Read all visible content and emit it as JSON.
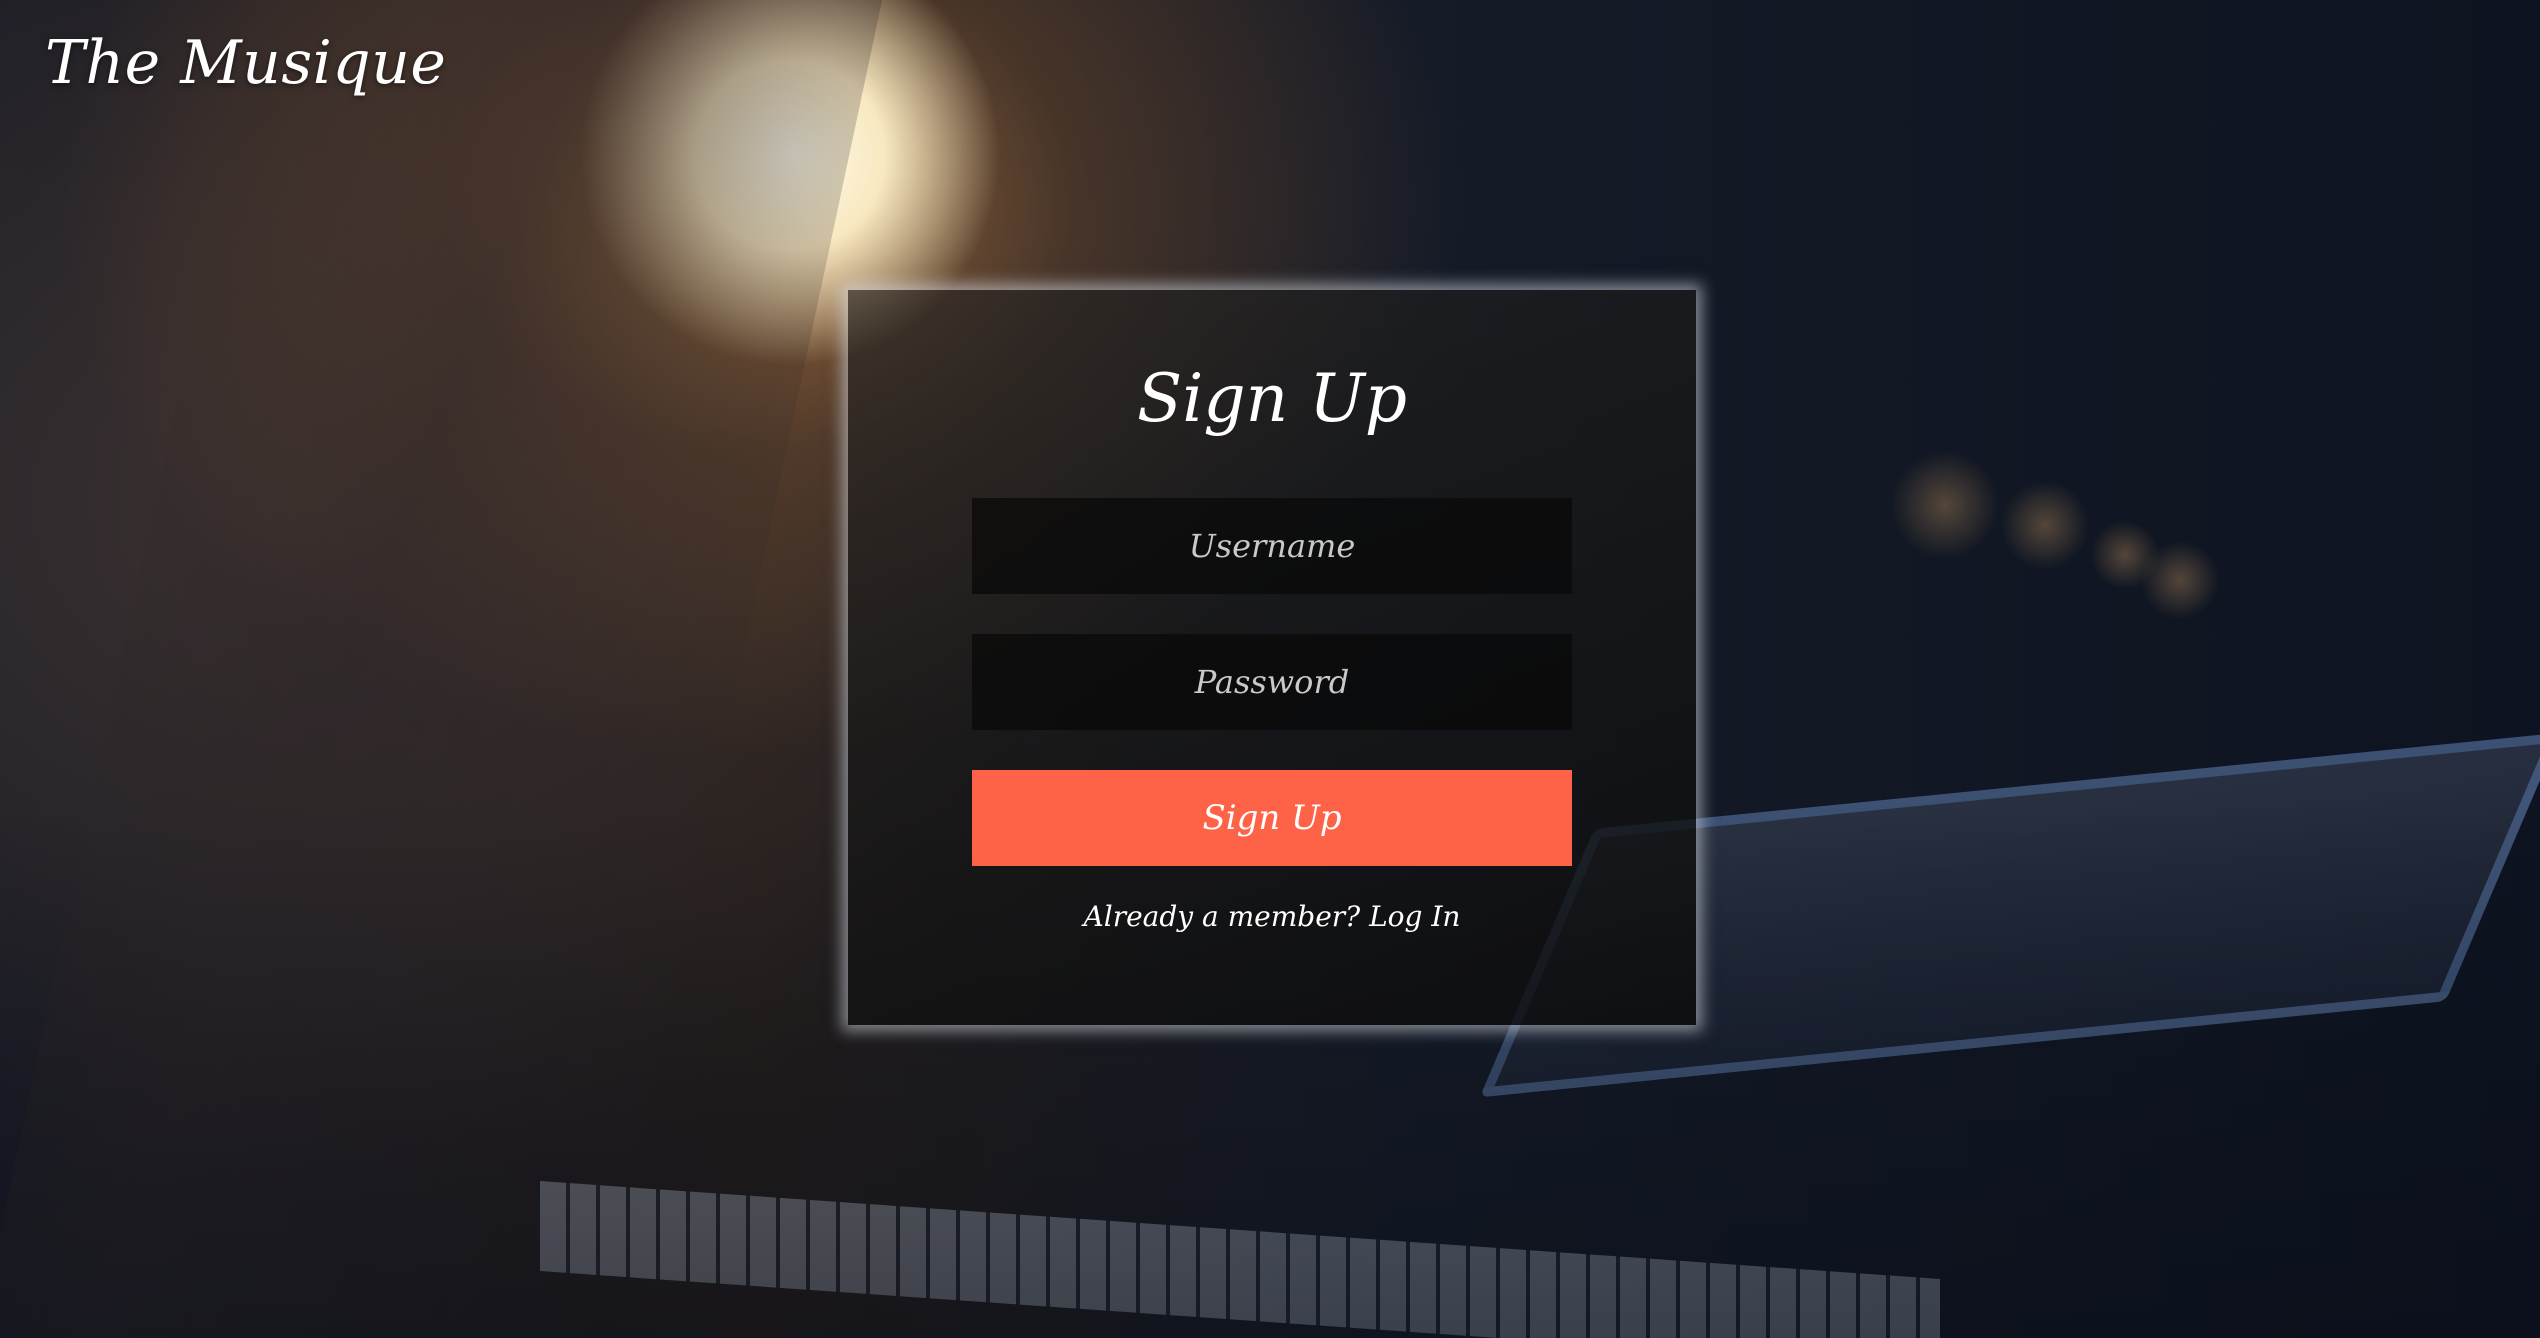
{
  "brand": {
    "title": "The Musique"
  },
  "signup_form": {
    "title": "Sign Up",
    "username": {
      "value": "",
      "placeholder": "Username"
    },
    "password": {
      "value": "",
      "placeholder": "Password"
    },
    "submit_label": "Sign Up",
    "member_prompt": "Already a member?",
    "login_link": "Log In"
  },
  "colors": {
    "accent": "#ff6347",
    "card_background": "#1a1a1a",
    "field_background": "#0a0a0a",
    "text": "#ffffff"
  }
}
